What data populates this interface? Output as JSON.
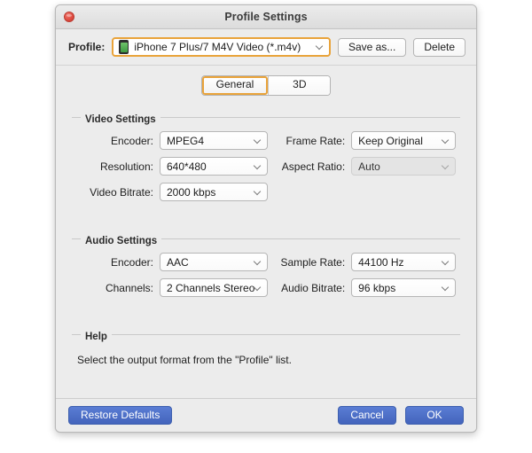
{
  "window": {
    "title": "Profile Settings",
    "close_icon": "close-icon"
  },
  "profile_bar": {
    "label": "Profile:",
    "device_icon": "iphone-icon",
    "value": "iPhone 7 Plus/7 M4V Video (*.m4v)",
    "save_as_label": "Save as...",
    "delete_label": "Delete"
  },
  "tabs": [
    {
      "label": "General",
      "selected": true
    },
    {
      "label": "3D",
      "selected": false
    }
  ],
  "video_settings": {
    "title": "Video Settings",
    "fields": [
      {
        "label": "Encoder:",
        "value": "MPEG4",
        "disabled": false
      },
      {
        "label": "Frame Rate:",
        "value": "Keep Original",
        "disabled": false
      },
      {
        "label": "Resolution:",
        "value": "640*480",
        "disabled": false
      },
      {
        "label": "Aspect Ratio:",
        "value": "Auto",
        "disabled": true
      },
      {
        "label": "Video Bitrate:",
        "value": "2000 kbps",
        "disabled": false
      }
    ]
  },
  "audio_settings": {
    "title": "Audio Settings",
    "fields": [
      {
        "label": "Encoder:",
        "value": "AAC",
        "disabled": false
      },
      {
        "label": "Sample Rate:",
        "value": "44100 Hz",
        "disabled": false
      },
      {
        "label": "Channels:",
        "value": "2 Channels Stereo",
        "disabled": false
      },
      {
        "label": "Audio Bitrate:",
        "value": "96 kbps",
        "disabled": false
      }
    ]
  },
  "help": {
    "title": "Help",
    "text": "Select the output format from the \"Profile\" list."
  },
  "footer": {
    "restore_defaults_label": "Restore Defaults",
    "cancel_label": "Cancel",
    "ok_label": "OK"
  },
  "colors": {
    "accent_focus": "#e9a33a",
    "button_blue": "#4364bc",
    "window_bg": "#ececec",
    "close_red": "#e04d42"
  }
}
